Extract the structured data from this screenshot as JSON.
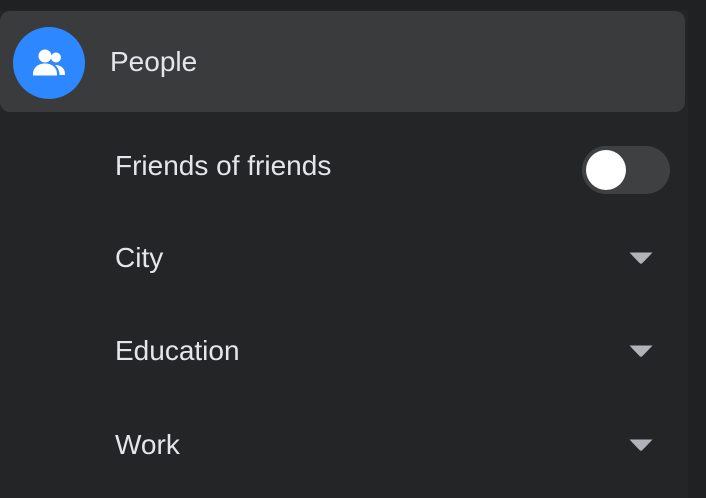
{
  "header": {
    "icon": "people-icon",
    "label": "People",
    "accent_color": "#2d88ff"
  },
  "filters": [
    {
      "label": "Friends of friends",
      "control": "toggle",
      "value": false
    },
    {
      "label": "City",
      "control": "dropdown",
      "icon": "caret-down-icon"
    },
    {
      "label": "Education",
      "control": "dropdown",
      "icon": "caret-down-icon"
    },
    {
      "label": "Work",
      "control": "dropdown",
      "icon": "caret-down-icon"
    }
  ]
}
